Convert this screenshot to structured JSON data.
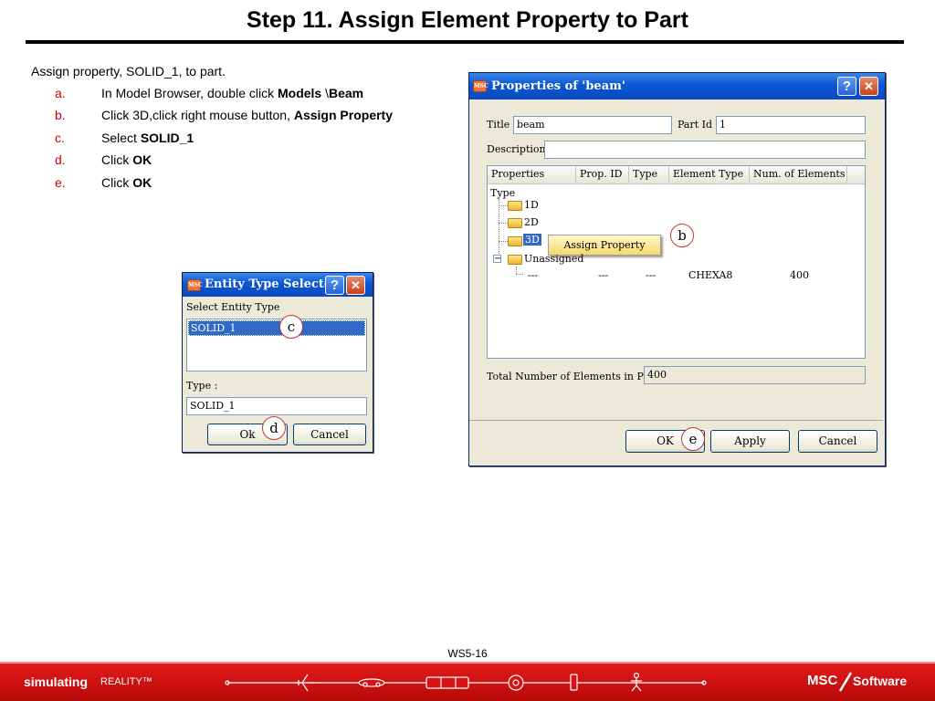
{
  "slide": {
    "title": "Step 11. Assign Element Property to Part",
    "intro": "Assign property, SOLID_1, to part.",
    "steps": [
      {
        "marker": "a.",
        "text": "In Model Browser, double click ",
        "bold": "Models",
        "text2": " \\",
        "bold2": "Beam"
      },
      {
        "marker": "b.",
        "text": "Click 3D,click right mouse button, ",
        "bold": "Assign Property",
        "text2": "",
        "bold2": ""
      },
      {
        "marker": "c.",
        "text": "Select ",
        "bold": "SOLID_1",
        "text2": "",
        "bold2": ""
      },
      {
        "marker": "d.",
        "text": "Click ",
        "bold": "OK",
        "text2": "",
        "bold2": ""
      },
      {
        "marker": "e.",
        "text": "Click ",
        "bold": "OK",
        "text2": "",
        "bold2": ""
      }
    ],
    "page_number": "WS5-16"
  },
  "entity_dialog": {
    "title": "Entity Type Selector",
    "help_glyph": "?",
    "close_glyph": "✕",
    "select_label": "Select Entity Type",
    "list_items": [
      "SOLID_1"
    ],
    "type_label": "Type :",
    "type_value": "SOLID_1",
    "ok_label": "Ok",
    "cancel_label": "Cancel"
  },
  "properties_dialog": {
    "title": "Properties of 'beam'",
    "help_glyph": "?",
    "close_glyph": "✕",
    "title_label": "Title",
    "title_value": "beam",
    "partid_label": "Part Id",
    "partid_value": "1",
    "description_label": "Description",
    "description_value": "",
    "columns": [
      "Properties",
      "Prop. ID",
      "Type",
      "Element Type",
      "Num. of Elements"
    ],
    "tree_root": "Type",
    "tree_nodes": [
      "1D",
      "2D",
      "3D",
      "Unassigned"
    ],
    "row": {
      "name": "---",
      "prop_id": "---",
      "type": "---",
      "element_type": "CHEXA8",
      "num_elements": "400"
    },
    "context_menu_item": "Assign Property",
    "total_label": "Total Number of Elements in Part",
    "total_value": "400",
    "ok_label": "OK",
    "apply_label": "Apply",
    "cancel_label": "Cancel",
    "expander_glyph": "−"
  },
  "callouts": {
    "b": "b",
    "c": "c",
    "d": "d",
    "e": "e"
  },
  "footer": {
    "brand_left": "simulating",
    "brand_left2": "REALITY™",
    "brand_right": "MSC",
    "brand_right2": "Software",
    "band_color": "#d91313"
  },
  "icons": [
    "app-icon",
    "help-icon",
    "close-icon",
    "folder-icon",
    "airplane-icon",
    "car-icon",
    "train-icon",
    "gear-icon",
    "phone-icon",
    "figure-icon"
  ]
}
